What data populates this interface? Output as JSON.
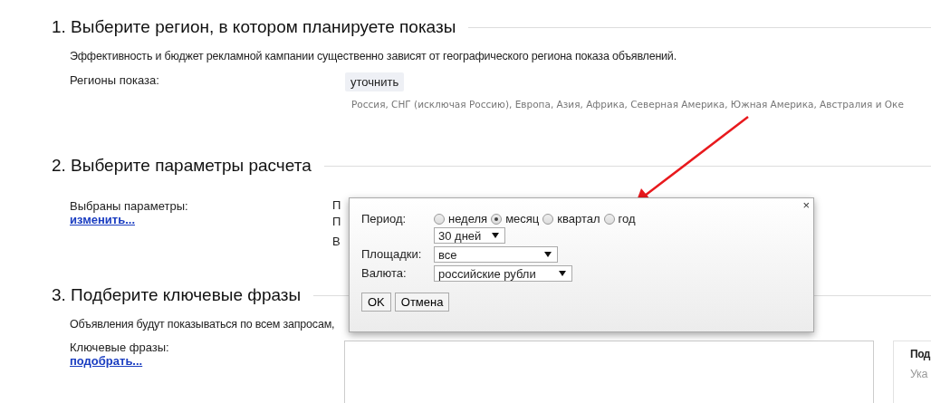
{
  "section_1": {
    "heading": "1. Выберите регион, в котором планируете показы",
    "description": "Эффективность и бюджет рекламной кампании существенно зависят от географического региона показа объявлений.",
    "label": "Регионы показа:",
    "button": "уточнить",
    "regions": "Россия, СНГ (исключая Россию), Европа, Азия, Африка, Северная Америка, Южная Америка, Австралия и Оке"
  },
  "section_2": {
    "heading": "2. Выберите параметры расчета",
    "label": "Выбраны параметры:",
    "link": "изменить...",
    "values": [
      "П",
      "П",
      "В"
    ]
  },
  "section_3": {
    "heading": "3. Подберите ключевые фразы",
    "description": "Объявления будут показываться по всем запросам,",
    "label": "Ключевые фразы:",
    "link": "подобрать...",
    "side_title": "Под",
    "side_text": "Ука"
  },
  "dialog": {
    "close": "×",
    "period_label": "Период:",
    "period_options": [
      {
        "label": "неделя",
        "selected": false
      },
      {
        "label": "месяц",
        "selected": true
      },
      {
        "label": "квартал",
        "selected": false
      },
      {
        "label": "год",
        "selected": false
      }
    ],
    "period_select": "30 дней",
    "platforms_label": "Площадки:",
    "platforms_select": "все",
    "currency_label": "Валюта:",
    "currency_select": "российские рубли",
    "buttons": [
      "OK",
      "Отмена"
    ]
  }
}
